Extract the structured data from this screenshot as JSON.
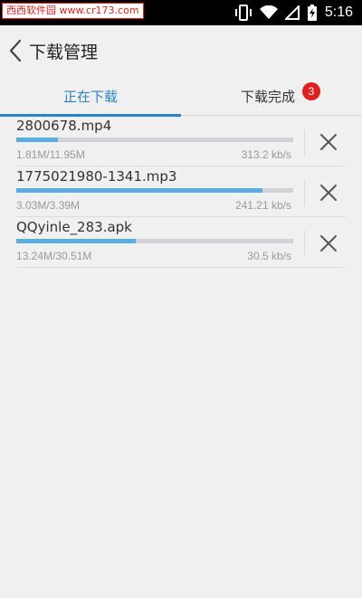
{
  "status_bar": {
    "watermark": "西西软件园 www.cr173.com",
    "time": "5:16",
    "icons": [
      "vibrate-icon",
      "wifi-icon",
      "signal-icon",
      "battery-icon"
    ]
  },
  "header": {
    "back_icon": "chevron-left-icon",
    "title": "下载管理"
  },
  "tabs": [
    {
      "label": "正在下载",
      "active": true
    },
    {
      "label": "下载完成",
      "active": false,
      "badge": "3"
    }
  ],
  "colors": {
    "accent": "#2b83c7",
    "progress": "#5aaede",
    "badge": "#e02020",
    "background": "#f0f0f0"
  },
  "downloads": [
    {
      "name": "2800678.mp4",
      "size": "1.81M/11.95M",
      "speed": "313.2  kb/s",
      "progress": 0.15
    },
    {
      "name": "1775021980-1341.mp3",
      "size": "3.03M/3.39M",
      "speed": "241.21 kb/s",
      "progress": 0.89
    },
    {
      "name": "QQyinle_283.apk",
      "size": "13.24M/30.51M",
      "speed": "30.5 kb/s",
      "progress": 0.43
    }
  ]
}
